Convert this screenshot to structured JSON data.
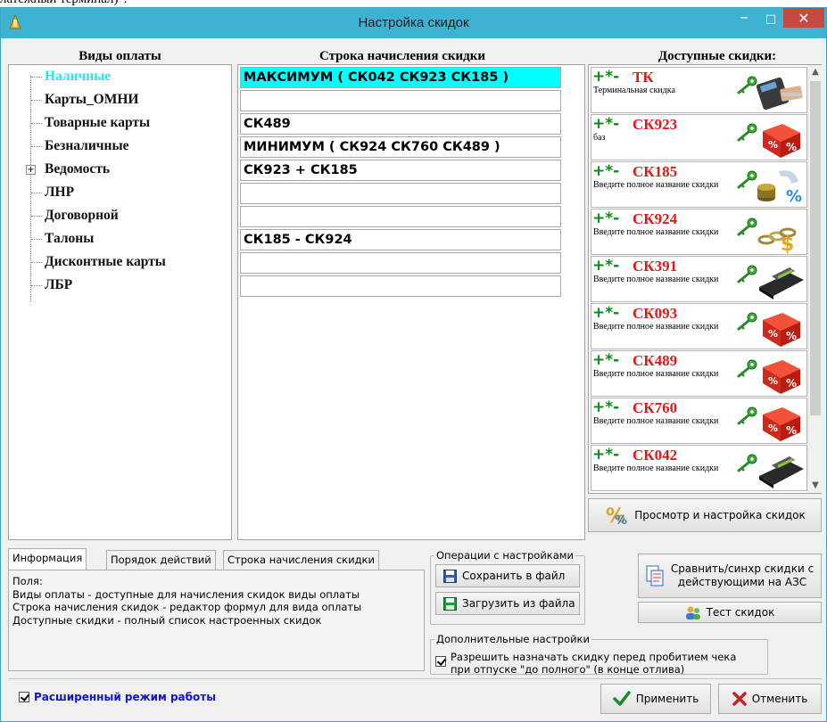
{
  "doc_fragment": "латежный терминал)\".",
  "window": {
    "title": "Настройка скидок",
    "min": "–",
    "max": "□",
    "close": "✕"
  },
  "headers": {
    "payment_types": "Виды оплаты",
    "formula_string": "Строка начисления скидки",
    "available_discounts": "Доступные скидки:"
  },
  "payment_types": [
    {
      "label": "Наличные",
      "selected": true,
      "expandable": false
    },
    {
      "label": "Карты_ОМНИ",
      "selected": false,
      "expandable": false
    },
    {
      "label": "Товарные карты",
      "selected": false,
      "expandable": false
    },
    {
      "label": "Безналичные",
      "selected": false,
      "expandable": false
    },
    {
      "label": "Ведомость",
      "selected": false,
      "expandable": true
    },
    {
      "label": "ЛНР",
      "selected": false,
      "expandable": false
    },
    {
      "label": "Договорной",
      "selected": false,
      "expandable": false
    },
    {
      "label": "Талоны",
      "selected": false,
      "expandable": false
    },
    {
      "label": "Дисконтные карты",
      "selected": false,
      "expandable": false
    },
    {
      "label": "ЛБР",
      "selected": false,
      "expandable": false
    }
  ],
  "formulas": [
    "МАКСИМУМ ( СК042 СК923 СК185 )",
    "",
    "СК489",
    "МИНИМУМ ( СК924 СК760 СК489 )",
    "СК923 + СК185",
    "",
    "",
    "СК185 - СК924",
    "",
    ""
  ],
  "discount_controls": "+*-",
  "discounts": [
    {
      "code": "ТК",
      "desc": "Терминальная скидка",
      "image": "payment-terminal-icon"
    },
    {
      "code": "СК923",
      "desc": "баз",
      "image": "percent-cube-icon"
    },
    {
      "code": "СК185",
      "desc": "Введите полное название скидки",
      "image": "coins-percent-icon"
    },
    {
      "code": "СК924",
      "desc": "Введите полное название скидки",
      "image": "dollar-chain-icon"
    },
    {
      "code": "СК391",
      "desc": "Введите полное название скидки",
      "image": "card-reader-icon"
    },
    {
      "code": "СК093",
      "desc": "Введите полное название скидки",
      "image": "percent-cube-icon"
    },
    {
      "code": "СК489",
      "desc": "Введите полное название скидки",
      "image": "percent-cube-icon"
    },
    {
      "code": "СК760",
      "desc": "Введите полное название скидки",
      "image": "percent-cube-icon"
    },
    {
      "code": "СК042",
      "desc": "Введите полное название скидки",
      "image": "card-reader-icon"
    }
  ],
  "buttons": {
    "view_setup": "Просмотр и настройка скидок",
    "save_file": "Сохранить в файл",
    "load_file": "Загрузить из файла",
    "compare_sync_line1": "Сравнить/синхр скидки с",
    "compare_sync_line2": "действующими  на АЗС",
    "test": "Тест скидок",
    "apply": "Применить",
    "cancel": "Отменить"
  },
  "tabs": [
    "Информация",
    "Порядок действий",
    "Строка начисления скидки"
  ],
  "info_text": [
    "Поля:",
    "Виды оплаты - доступные для начисления скидок виды оплаты",
    "Строка начисления скидок - редактор формул для вида оплаты",
    "Доступные скидки - полный список настроенных скидок"
  ],
  "groups": {
    "operations": "Операции с настройками",
    "additional": "Дополнительные настройки"
  },
  "checkbox_discount_before_receipt": {
    "line1": "Разрешить назначать скидку перед пробитием чека",
    "line2": "при отпуске \"до полного\" (в конце отлива)",
    "checked": true
  },
  "checkbox_extended_mode": {
    "label": "Расширенный режим работы",
    "checked": true
  },
  "colors": {
    "titlebar": "#3fb1d3",
    "selected_row": "#00ffff",
    "tree_selected_text": "#2be2ea",
    "discount_code": "#e01818",
    "discount_controls": "#0c8a1a",
    "extended_mode_text": "#1414c8"
  }
}
